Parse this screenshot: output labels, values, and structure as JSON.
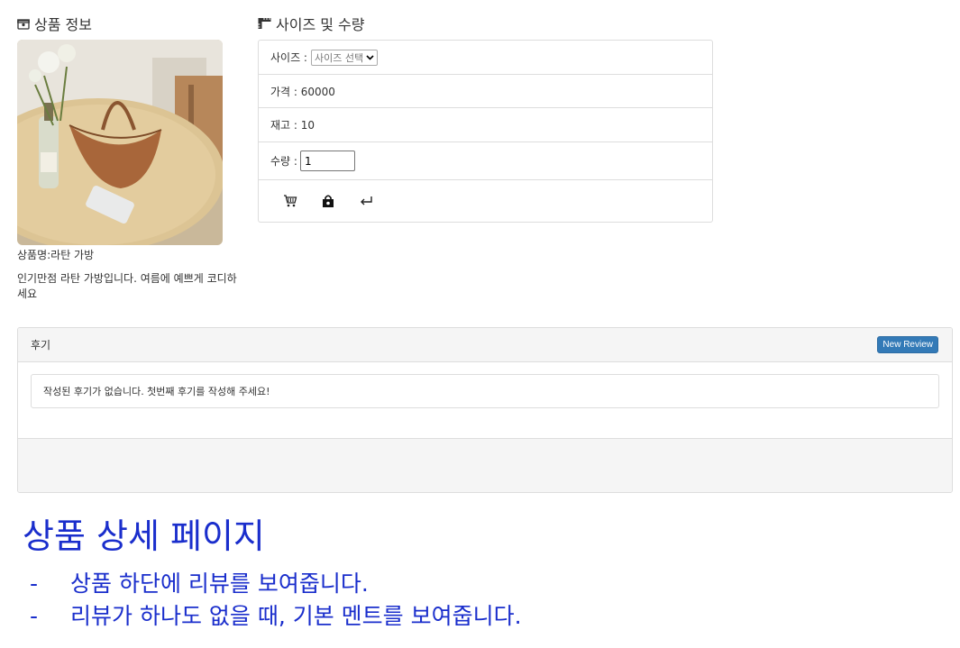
{
  "product_info": {
    "title": "상품 정보",
    "name_text": "상품명:라탄 가방",
    "description": "인기만점 라탄 가방입니다. 여름에 예쁘게 코디하세요"
  },
  "size_section": {
    "title": "사이즈 및 수량",
    "size_label": "사이즈 :",
    "size_select_value": "사이즈 선택",
    "price_text": "가격 : 60000",
    "stock_text": "재고 : 10",
    "qty_label": "수량 :",
    "qty_value": "1"
  },
  "actions": [
    "cart-icon",
    "shopping-bag-icon",
    "return-icon"
  ],
  "review": {
    "title": "후기",
    "new_button": "New Review",
    "empty_message": "작성된 후기가 없습니다. 첫번째 후기를 작성해 주세요!"
  },
  "caption": {
    "title": "상품 상세 페이지",
    "bullets": [
      {
        "dash": "-",
        "text": "상품 하단에 리뷰를 보여줍니다."
      },
      {
        "dash": "-",
        "text": "리뷰가 하나도 없을 때, 기본 멘트를 보여줍니다."
      }
    ]
  },
  "colors": {
    "accent_blue": "#337ab7",
    "caption_blue": "#1a2ecc",
    "panel_gray": "#f5f5f5"
  }
}
